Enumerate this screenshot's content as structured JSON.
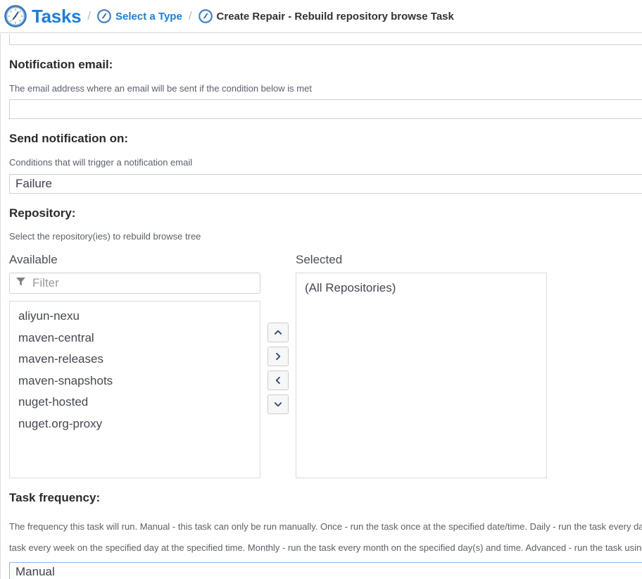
{
  "header": {
    "breadcrumb": [
      {
        "label": "Tasks",
        "icon": "clock-icon",
        "kind": "root-link"
      },
      {
        "label": "Select a Type",
        "icon": "clock-icon",
        "kind": "link"
      },
      {
        "label": "Create Repair - Rebuild repository browse Task",
        "icon": "clock-icon",
        "kind": "current"
      }
    ],
    "separator": "/"
  },
  "colors": {
    "link": "#1c7ed6",
    "text": "#333333",
    "help_text": "#5b6069",
    "border": "#cfcfcf",
    "focus_border": "#86b7e8",
    "chevron": "#2e4a73"
  },
  "form": {
    "truncated_field_above": {
      "value": ""
    },
    "notification_email": {
      "label": "Notification email:",
      "help": "The email address where an email will be sent if the condition below is met",
      "value": "",
      "placeholder": ""
    },
    "send_notification_on": {
      "label": "Send notification on:",
      "help": "Conditions that will trigger a notification email",
      "value": "Failure",
      "options": [
        "Failure"
      ]
    },
    "repository": {
      "label": "Repository:",
      "help": "Select the repository(ies) to rebuild browse tree",
      "available": {
        "title": "Available",
        "filter_placeholder": "Filter",
        "filter_value": "",
        "filter_icon": "funnel-icon",
        "items": [
          "aliyun-nexu",
          "maven-central",
          "maven-releases",
          "maven-snapshots",
          "nuget-hosted",
          "nuget.org-proxy"
        ]
      },
      "selected": {
        "title": "Selected",
        "items": [
          "(All Repositories)"
        ]
      },
      "transfer_buttons": [
        {
          "name": "move-up-button",
          "icon": "chevron-up-icon"
        },
        {
          "name": "move-right-button",
          "icon": "chevron-right-icon"
        },
        {
          "name": "move-left-button",
          "icon": "chevron-left-icon"
        },
        {
          "name": "move-down-button",
          "icon": "chevron-down-icon"
        }
      ]
    },
    "task_frequency": {
      "label": "Task frequency:",
      "help": "The frequency this task will run. Manual - this task can only be run manually. Once - run the task once at the specified date/time. Daily - run the task every day at the specified time. Weekly - run the task every week on the specified day at the specified time. Monthly - run the task every month on the specified day(s) and time. Advanced - run the task using the supplied cron string.",
      "value": "Manual",
      "options": [
        "Manual"
      ]
    }
  }
}
